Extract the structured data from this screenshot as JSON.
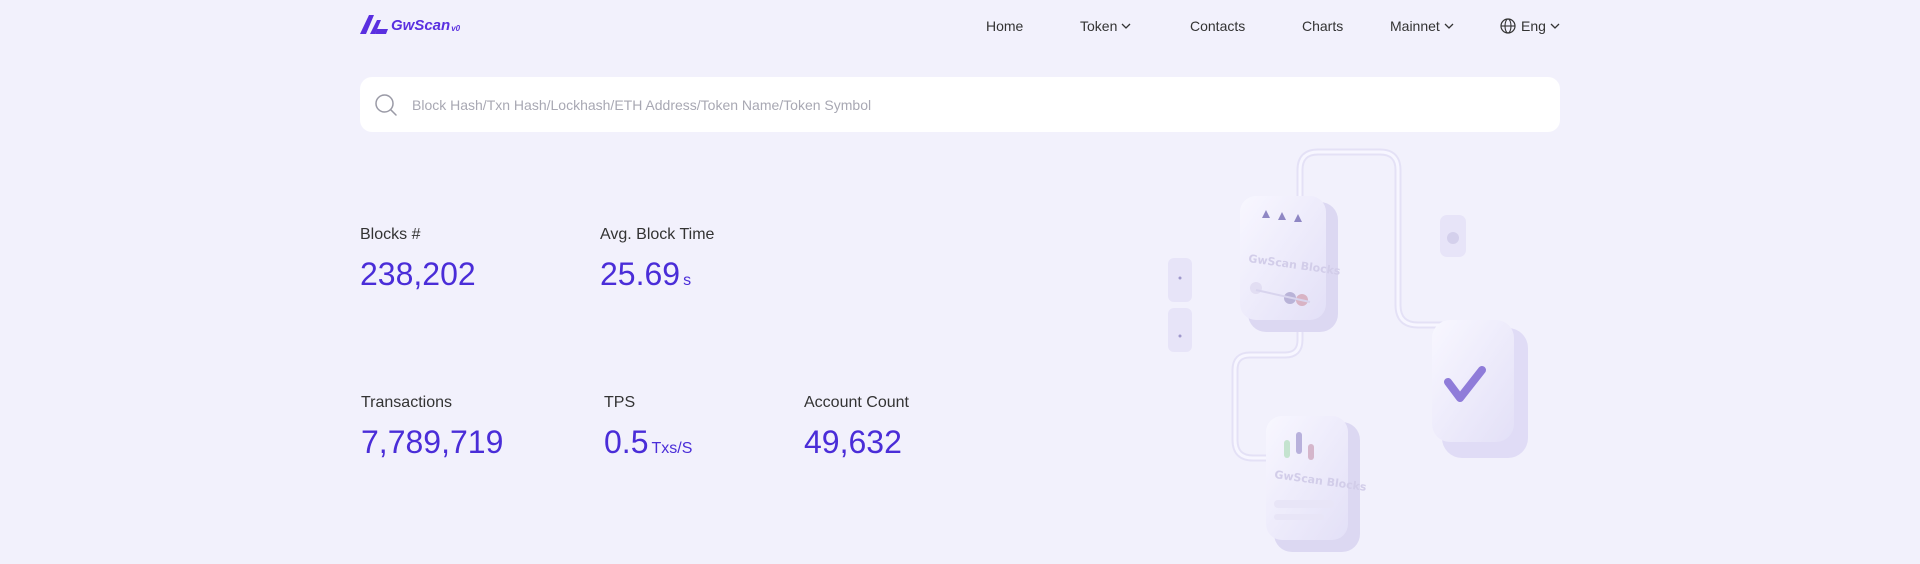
{
  "header": {
    "logo_text": "GwScan",
    "logo_version": "v0",
    "nav": {
      "home": "Home",
      "token": "Token",
      "contacts": "Contacts",
      "charts": "Charts",
      "network": "Mainnet",
      "language": "Eng"
    }
  },
  "search": {
    "placeholder": "Block Hash/Txn Hash/Lockhash/ETH Address/Token Name/Token Symbol",
    "value": ""
  },
  "stats": {
    "blocks": {
      "label": "Blocks #",
      "value": "238,202"
    },
    "avg_block_time": {
      "label": "Avg. Block Time",
      "value": "25.69",
      "unit": "s"
    },
    "transactions": {
      "label": "Transactions",
      "value": "7,789,719"
    },
    "tps": {
      "label": "TPS",
      "value": "0.5",
      "unit": "Txs/S"
    },
    "account_count": {
      "label": "Account Count",
      "value": "49,632"
    }
  },
  "illustration": {
    "card_caption": "GwScan Blocks"
  },
  "colors": {
    "accent": "#4a2dd8",
    "logo": "#5a2fe0",
    "background": "#f2f1fc"
  }
}
